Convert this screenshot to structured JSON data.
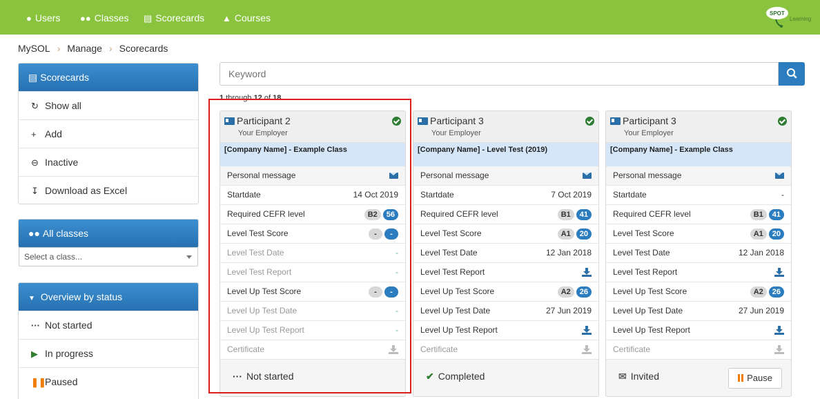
{
  "nav": {
    "items": [
      {
        "label": "Users",
        "icon": "user-icon"
      },
      {
        "label": "Classes",
        "icon": "users-icon"
      },
      {
        "label": "Scorecards",
        "icon": "id-card-icon"
      },
      {
        "label": "Courses",
        "icon": "graduation-cap-icon"
      }
    ],
    "logo_text": "SPOT",
    "logo_sub": "Learning"
  },
  "breadcrumb": [
    "MySOL",
    "Manage",
    "Scorecards"
  ],
  "sidebar": {
    "scorecards": {
      "title": "Scorecards",
      "items": [
        {
          "label": "Show all",
          "icon": "refresh-icon"
        },
        {
          "label": "Add",
          "icon": "plus-icon"
        },
        {
          "label": "Inactive",
          "icon": "minus-circle-icon"
        },
        {
          "label": "Download as Excel",
          "icon": "download-icon"
        }
      ]
    },
    "classes": {
      "title": "All classes",
      "select_value": "Select a class..."
    },
    "status": {
      "title": "Overview by status",
      "items": [
        {
          "label": "Not started",
          "icon": "ellipsis-icon"
        },
        {
          "label": "In progress",
          "icon": "play-icon"
        },
        {
          "label": "Paused",
          "icon": "pause-icon"
        }
      ]
    }
  },
  "search": {
    "placeholder": "Keyword"
  },
  "paging": {
    "from": "1",
    "word_through": "through",
    "to": "12",
    "word_of": "of",
    "total": "18"
  },
  "cards": [
    {
      "name": "Participant 2",
      "employer": "Your Employer",
      "class": "[Company Name] - Example Class",
      "rows": {
        "personal_message": "Personal message",
        "startdate_label": "Startdate",
        "startdate": "14 Oct 2019",
        "cefr_label": "Required CEFR level",
        "cefr_level": "B2",
        "cefr_score": "56",
        "lts_label": "Level Test Score",
        "lts_level": "-",
        "lts_score": "-",
        "ltd_label": "Level Test Date",
        "ltd": "-",
        "ltr_label": "Level Test Report",
        "ltr": "-",
        "luts_label": "Level Up Test Score",
        "luts_level": "-",
        "luts_score": "-",
        "lutd_label": "Level Up Test Date",
        "lutd": "-",
        "lutr_label": "Level Up Test Report",
        "lutr": "-",
        "cert_label": "Certificate"
      },
      "status": "Not started"
    },
    {
      "name": "Participant 3",
      "employer": "Your Employer",
      "class": "[Company Name] - Level Test (2019)",
      "rows": {
        "personal_message": "Personal message",
        "startdate_label": "Startdate",
        "startdate": "7 Oct 2019",
        "cefr_label": "Required CEFR level",
        "cefr_level": "B1",
        "cefr_score": "41",
        "lts_label": "Level Test Score",
        "lts_level": "A1",
        "lts_score": "20",
        "ltd_label": "Level Test Date",
        "ltd": "12 Jan 2018",
        "ltr_label": "Level Test Report",
        "luts_label": "Level Up Test Score",
        "luts_level": "A2",
        "luts_score": "26",
        "lutd_label": "Level Up Test Date",
        "lutd": "27 Jun 2019",
        "lutr_label": "Level Up Test Report",
        "cert_label": "Certificate"
      },
      "status": "Completed"
    },
    {
      "name": "Participant 3",
      "employer": "Your Employer",
      "class": "[Company Name] - Example Class",
      "rows": {
        "personal_message": "Personal message",
        "startdate_label": "Startdate",
        "startdate": "-",
        "cefr_label": "Required CEFR level",
        "cefr_level": "B1",
        "cefr_score": "41",
        "lts_label": "Level Test Score",
        "lts_level": "A1",
        "lts_score": "20",
        "ltd_label": "Level Test Date",
        "ltd": "12 Jan 2018",
        "ltr_label": "Level Test Report",
        "luts_label": "Level Up Test Score",
        "luts_level": "A2",
        "luts_score": "26",
        "lutd_label": "Level Up Test Date",
        "lutd": "27 Jun 2019",
        "lutr_label": "Level Up Test Report",
        "cert_label": "Certificate"
      },
      "status": "Invited",
      "pause_label": "Pause"
    }
  ],
  "colors": {
    "nav_green": "#8ac43f",
    "primary_blue": "#2b7dc0",
    "highlight_red": "#d9201b"
  }
}
